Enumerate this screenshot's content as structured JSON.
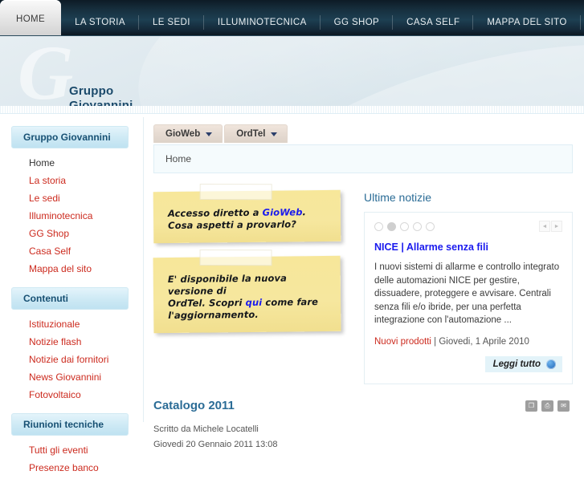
{
  "topnav": {
    "items": [
      {
        "label": "HOME",
        "active": true
      },
      {
        "label": "LA STORIA",
        "active": false
      },
      {
        "label": "LE SEDI",
        "active": false
      },
      {
        "label": "ILLUMINOTECNICA",
        "active": false
      },
      {
        "label": "GG SHOP",
        "active": false
      },
      {
        "label": "CASA SELF",
        "active": false
      },
      {
        "label": "MAPPA DEL SITO",
        "active": false
      }
    ]
  },
  "header": {
    "logo_line1": "Gruppo",
    "logo_line2": "Giovannini",
    "watermark": "G"
  },
  "sidebar": {
    "modules": [
      {
        "title": "Gruppo Giovannini",
        "items": [
          {
            "label": "Home",
            "current": true
          },
          {
            "label": "La storia",
            "current": false
          },
          {
            "label": "Le sedi",
            "current": false
          },
          {
            "label": "Illuminotecnica",
            "current": false
          },
          {
            "label": "GG Shop",
            "current": false
          },
          {
            "label": "Casa Self",
            "current": false
          },
          {
            "label": "Mappa del sito",
            "current": false
          }
        ]
      },
      {
        "title": "Contenuti",
        "items": [
          {
            "label": "Istituzionale",
            "current": false
          },
          {
            "label": "Notizie flash",
            "current": false
          },
          {
            "label": "Notizie dai fornitori",
            "current": false
          },
          {
            "label": "News Giovannini",
            "current": false
          },
          {
            "label": "Fotovoltaico",
            "current": false
          }
        ]
      },
      {
        "title": "Riunioni tecniche",
        "items": [
          {
            "label": "Tutti gli eventi",
            "current": false
          },
          {
            "label": "Presenze banco",
            "current": false
          }
        ]
      }
    ]
  },
  "content": {
    "tabs": [
      {
        "label": "GioWeb"
      },
      {
        "label": "OrdTel"
      }
    ],
    "breadcrumb": "Home",
    "notes": [
      {
        "line1_pre": "Accesso diretto a ",
        "link": "GioWeb",
        "line1_post": ".",
        "line2": "Cosa aspetti a provarlo?"
      },
      {
        "line1": "E' disponibile la nuova versione di",
        "line2_pre": "OrdTel. Scopri ",
        "link": "qui",
        "line2_post": " come fare",
        "line3": "l'aggiornamento."
      }
    ],
    "news": {
      "heading": "Ultime notizie",
      "dots": 5,
      "active_dot": 2,
      "prev_arrow": "◄",
      "next_arrow": "►",
      "title": "NICE | Allarme senza fili",
      "body": "I nuovi sistemi di allarme e controllo integrato delle automazioni NICE per gestire, dissuadere, proteggere e avvisare. Centrali senza fili e/o ibride, per una perfetta integrazione con l'automazione ...",
      "category": "Nuovi prodotti",
      "meta_separator": " | ",
      "date": "Giovedi, 1 Aprile 2010",
      "readmore": "Leggi tutto"
    },
    "article": {
      "title": "Catalogo 2011",
      "author": "Scritto da Michele Locatelli",
      "date": "Giovedi 20 Gennaio 2011 13:08",
      "tools": [
        {
          "name": "pdf-icon",
          "glyph": "❐"
        },
        {
          "name": "print-icon",
          "glyph": "⎙"
        },
        {
          "name": "email-icon",
          "glyph": "✉"
        }
      ]
    }
  }
}
